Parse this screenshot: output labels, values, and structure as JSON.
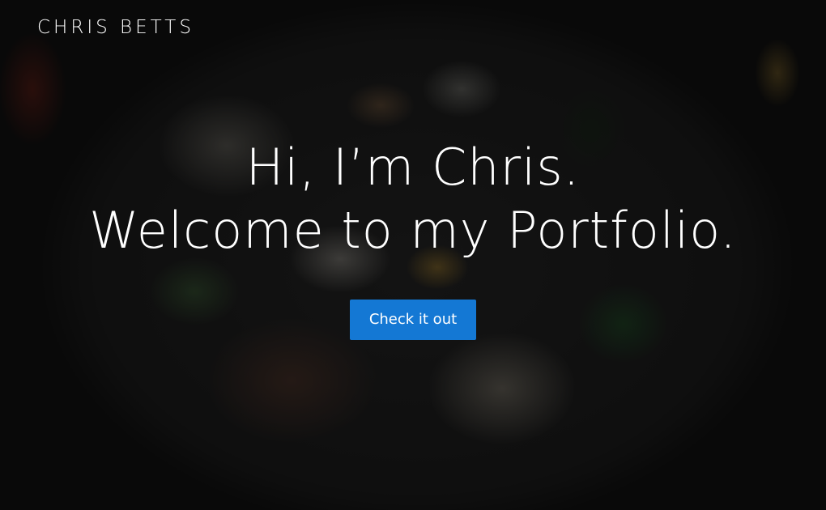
{
  "header": {
    "brand": "CHRIS BETTS"
  },
  "hero": {
    "line1": "Hi, I’m Chris.",
    "line2": "Welcome to my Portfolio.",
    "cta_label": "Check it out"
  },
  "colors": {
    "accent": "#1478d4",
    "text": "#ffffff"
  }
}
